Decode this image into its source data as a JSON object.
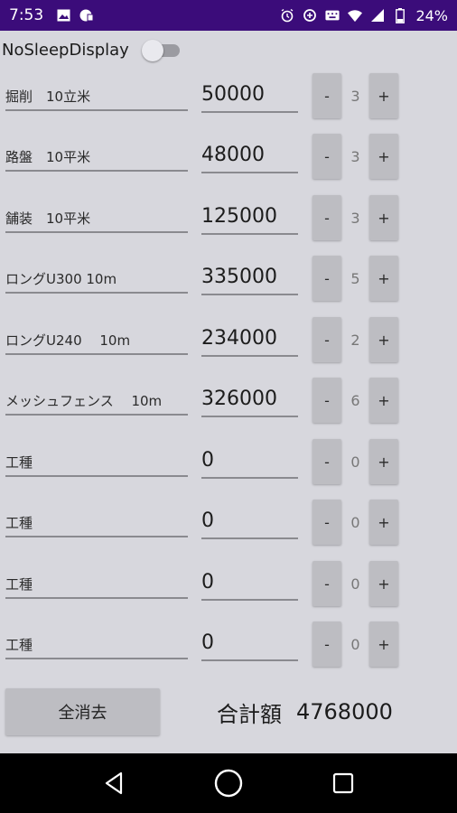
{
  "status_bar": {
    "time": "7:53",
    "battery": "24%",
    "left_icons": [
      "image-icon",
      "vpn-lock-icon"
    ],
    "right_icons": [
      "alarm-icon",
      "data-saver-icon",
      "keyboard-icon",
      "wifi-icon",
      "signal-icon",
      "battery-icon"
    ],
    "background": "#3b0c7a"
  },
  "toggle": {
    "label": "NoSleepDisplay",
    "on": false
  },
  "rows": [
    {
      "name": "掘削　10立米",
      "price": "50000",
      "minus": "-",
      "qty": "3",
      "plus": "+"
    },
    {
      "name": "路盤　10平米",
      "price": "48000",
      "minus": "-",
      "qty": "3",
      "plus": "+"
    },
    {
      "name": "舗装　10平米",
      "price": "125000",
      "minus": "-",
      "qty": "3",
      "plus": "+"
    },
    {
      "name": "ロングU300 10m",
      "price": "335000",
      "minus": "-",
      "qty": "5",
      "plus": "+"
    },
    {
      "name": "ロングU240　 10m",
      "price": "234000",
      "minus": "-",
      "qty": "2",
      "plus": "+"
    },
    {
      "name": "メッシュフェンス　 10m",
      "price": "326000",
      "minus": "-",
      "qty": "6",
      "plus": "+"
    },
    {
      "name": "工種",
      "price": "0",
      "minus": "-",
      "qty": "0",
      "plus": "+"
    },
    {
      "name": "工種",
      "price": "0",
      "minus": "-",
      "qty": "0",
      "plus": "+"
    },
    {
      "name": "工種",
      "price": "0",
      "minus": "-",
      "qty": "0",
      "plus": "+"
    },
    {
      "name": "工種",
      "price": "0",
      "minus": "-",
      "qty": "0",
      "plus": "+"
    }
  ],
  "footer": {
    "clear_label": "全消去",
    "total_label": "合計額",
    "total_value": "4768000"
  },
  "nav": {
    "icons": [
      "back-icon",
      "home-icon",
      "recents-icon"
    ]
  }
}
